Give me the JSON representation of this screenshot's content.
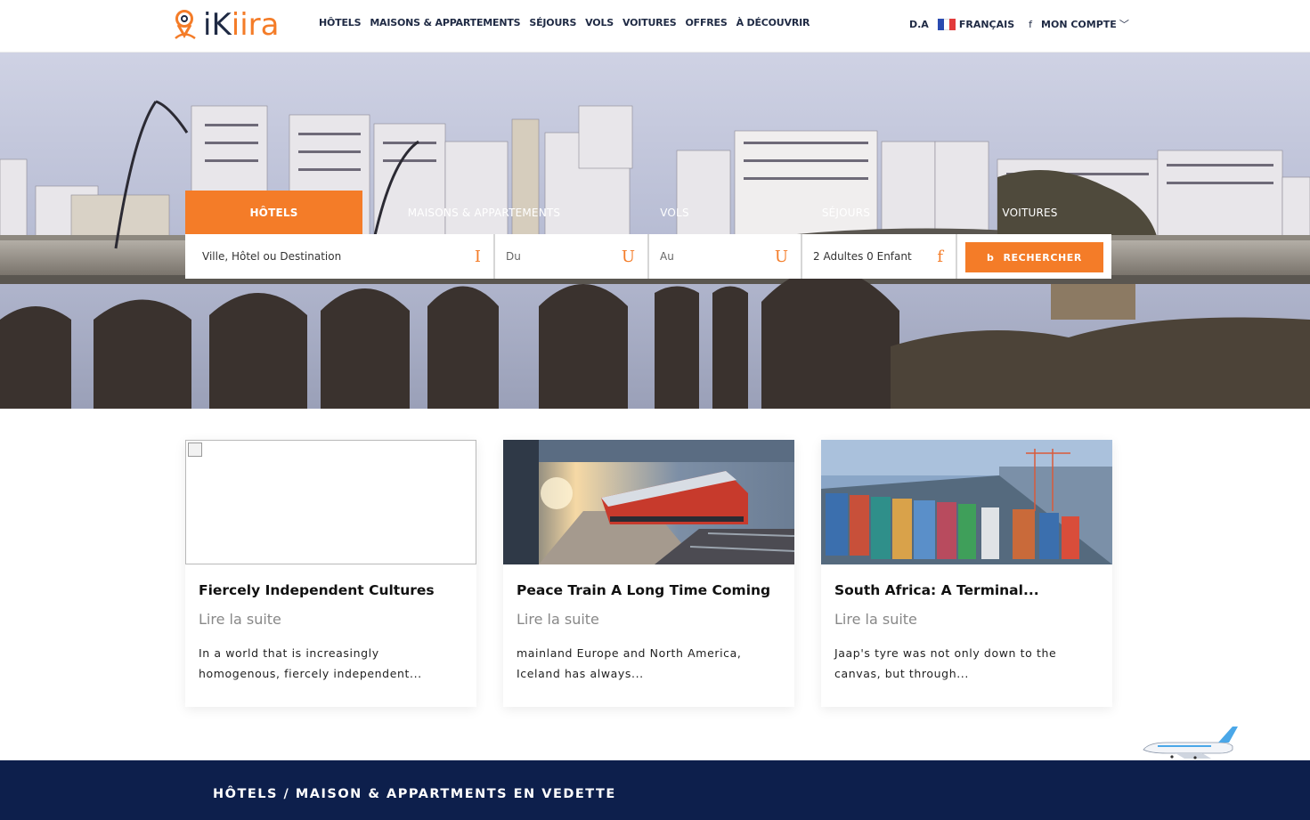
{
  "brand": {
    "logo_text_a": "iK",
    "logo_text_b": "iira"
  },
  "nav": [
    "HÔTELS",
    "MAISONS & APPARTEMENTS",
    "SÉJOURS",
    "VOLS",
    "VOITURES",
    "OFFRES",
    "À DÉCOUVRIR"
  ],
  "header_right": {
    "currency": "D.A",
    "language": "FRANÇAIS",
    "facebook_glyph": "f",
    "account": "MON COMPTE",
    "chevron": "﹀"
  },
  "search": {
    "tabs": [
      "HÔTELS",
      "MAISONS & APPARTEMENTS",
      "VOLS",
      "SÉJOURS",
      "VOITURES"
    ],
    "active_tab": 0,
    "destination": "Ville, Hôtel ou Destination",
    "destination_icon": "I",
    "date_from": "Du",
    "date_from_icon": "U",
    "date_to": "Au",
    "date_to_icon": "U",
    "guests": "2 Adultes 0 Enfant",
    "guests_icon": "f",
    "button_icon": "b",
    "button_label": "RECHERCHER"
  },
  "cards": [
    {
      "title": "Fiercely Independent Cultures",
      "more": "Lire la suite",
      "excerpt_1": "In a world that is increasingly",
      "excerpt_2": "homogenous, fiercely independent..."
    },
    {
      "title": "Peace Train A Long Time Coming",
      "more": "Lire la suite",
      "excerpt_1": " mainland Europe and North America,",
      "excerpt_2": "Iceland has always..."
    },
    {
      "title": "South Africa: A Terminal...",
      "more": "Lire la suite",
      "excerpt_1": "Jaap's tyre was not only down to the",
      "excerpt_2": "canvas, but through..."
    }
  ],
  "featured_heading": "HÔTELS / MAISON & APPARTMENTS EN VEDETTE",
  "colors": {
    "accent": "#f47c28",
    "navy": "#0d1f4c",
    "text": "#1f2a44"
  }
}
